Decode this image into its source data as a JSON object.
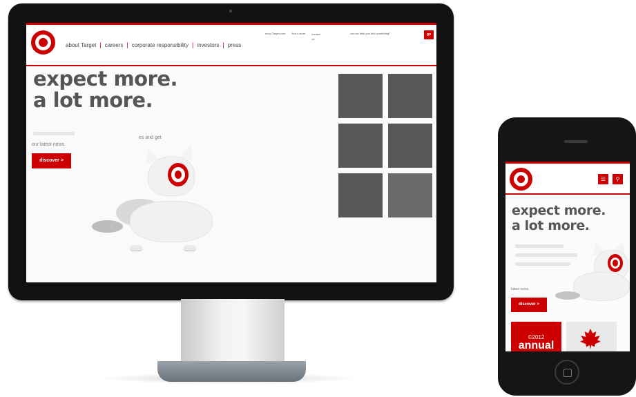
{
  "brand_color": "#cc0000",
  "desktop": {
    "logo": "target-bullseye-icon",
    "nav": [
      "about Target",
      "careers",
      "corporate responsibility",
      "investors",
      "press"
    ],
    "nav_separator": "|",
    "utility_links": [
      "shop Target.com",
      "find a store",
      "contact us"
    ],
    "help_text": "can we help you find something?",
    "go_label": "go",
    "headline": [
      "expect more.",
      "a lot more."
    ],
    "latest_news_text": "our latest news.",
    "fragment_text": "es and get",
    "discover_label": "discover >",
    "tile_count_label": ""
  },
  "phone": {
    "logo": "target-bullseye-icon",
    "menu_icon": "menu-icon",
    "search_icon": "search-icon",
    "headline": [
      "expect more.",
      "a lot more."
    ],
    "latest_news_text": "latest news.",
    "discover_label": "discover >",
    "card_year": "©2012",
    "card_title": "annual",
    "card2_icon": "maple-leaf-icon"
  }
}
